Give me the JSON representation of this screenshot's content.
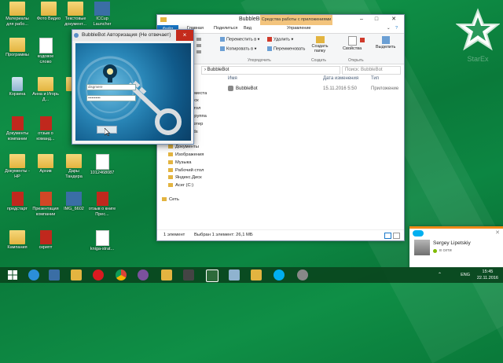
{
  "desktop": {
    "watermark": "StarEx",
    "icons": [
      {
        "label": "Материалы для рабо...",
        "type": "folder"
      },
      {
        "label": "Фото Видео",
        "type": "folder"
      },
      {
        "label": "Текстовые документ...",
        "type": "folder"
      },
      {
        "label": "ICCup Launcher",
        "type": "exe"
      },
      {
        "label": "Программы",
        "type": "folder"
      },
      {
        "label": "кодовое слово",
        "type": "doc"
      },
      {
        "label": "Корзина",
        "type": "bin"
      },
      {
        "label": "Анна и Игорь Д...",
        "type": "folder"
      },
      {
        "label": "Ви",
        "type": "folder"
      },
      {
        "label": "Документы компании",
        "type": "pdf"
      },
      {
        "label": "отзыв о команд...",
        "type": "pdf"
      },
      {
        "label": "Документы - НР",
        "type": "folder"
      },
      {
        "label": "Архив",
        "type": "folder"
      },
      {
        "label": "Дары Тандера",
        "type": "folder"
      },
      {
        "label": "1012468087",
        "type": "doc"
      },
      {
        "label": "предстарт",
        "type": "pdf"
      },
      {
        "label": "Презентация компании",
        "type": "ppt"
      },
      {
        "label": "IMG_6602",
        "type": "exe"
      },
      {
        "label": "отзыв о книге Прес...",
        "type": "pdf"
      },
      {
        "label": "Кампания",
        "type": "folder"
      },
      {
        "label": "скрипт",
        "type": "pdf"
      },
      {
        "label": "kniga-strat...",
        "type": "doc"
      }
    ]
  },
  "explorer": {
    "title": "BubbleBot",
    "context_tab": "Средства работы с приложениями",
    "tabs": {
      "file": "Файл",
      "home": "Главная",
      "share": "Поделиться",
      "view": "Вид",
      "manage": "Управление"
    },
    "ribbon": {
      "move_to": "Переместить в",
      "copy_to": "Копировать в",
      "delete": "Удалить",
      "rename": "Переименовать",
      "new_folder": "Создать папку",
      "properties": "Свойства",
      "layout": "Выделить",
      "group_organize": "Упорядочить",
      "group_create": "Создать",
      "group_open": "Открыть"
    },
    "address": "BubbleBot",
    "search_placeholder": "Поиск: BubbleBot",
    "columns": {
      "name": "Имя",
      "date": "Дата изменения",
      "type": "Тип"
    },
    "files": [
      {
        "name": "BubbleBot",
        "date": "15.11.2016 5:50",
        "type": "Приложение"
      }
    ],
    "nav": [
      "Избранное",
      "Загрузки",
      "Недавние места",
      "Яндекс.Диск",
      "Рабочий стол",
      "Домашняя группа",
      "Этот компьютер",
      "Downloads",
      "Видео",
      "Документы",
      "Изображения",
      "Музыка",
      "Рабочий стол",
      "Яндекс.Диск",
      "Acer (C:)",
      "Сеть"
    ],
    "status_count": "1 элемент",
    "status_selected": "Выбран 1 элемент: 26,1 МБ"
  },
  "dialog": {
    "title": "BubbleBot Авторизация (Не отвечает)",
    "login_value": "disgmere",
    "password_value": "••••••••••",
    "close": "×"
  },
  "toast": {
    "name": "Sergey Lipetskiy",
    "status": "в сети"
  },
  "taskbar": {
    "lang": "ENG",
    "time": "15:45",
    "date": "22.11.2016"
  },
  "colors": {
    "accent": "#1979ca",
    "desktop": "#0f8f46",
    "toast_accent": "#ef8a18"
  }
}
